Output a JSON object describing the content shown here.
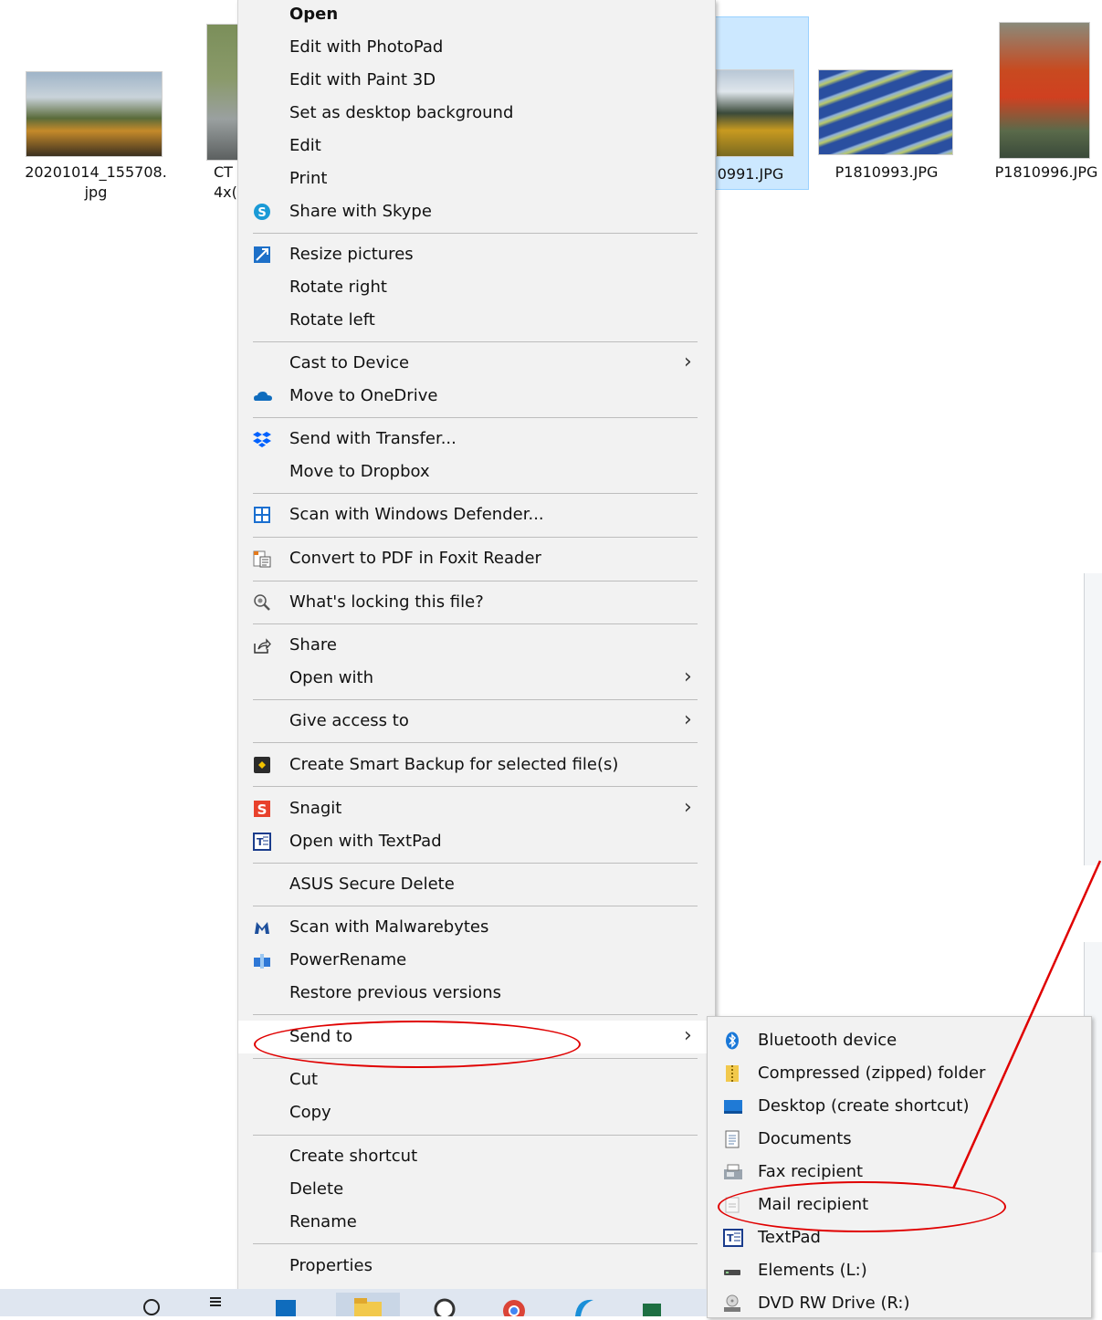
{
  "explorer": {
    "files": [
      {
        "name_line1": "20201014_155708.",
        "name_line2": "jpg"
      },
      {
        "name_line1": "CT",
        "name_line2": "4x("
      },
      {
        "name_line1": "0991.JPG",
        "name_line2": ""
      },
      {
        "name_line1": "P1810993.JPG",
        "name_line2": ""
      },
      {
        "name_line1": "P1810996.JPG",
        "name_line2": ""
      }
    ]
  },
  "context_menu": {
    "items": [
      {
        "label": "Open",
        "icon": "none"
      },
      {
        "label": "Edit with PhotoPad",
        "icon": "none"
      },
      {
        "label": "Edit with Paint 3D",
        "icon": "none"
      },
      {
        "label": "Set as desktop background",
        "icon": "none"
      },
      {
        "label": "Edit",
        "icon": "none"
      },
      {
        "label": "Print",
        "icon": "none"
      },
      {
        "label": "Share with Skype",
        "icon": "skype-icon"
      },
      {
        "label": "Resize pictures",
        "icon": "resize-pictures-icon"
      },
      {
        "label": "Rotate right",
        "icon": "none"
      },
      {
        "label": "Rotate left",
        "icon": "none"
      },
      {
        "label": "Cast to Device",
        "icon": "none"
      },
      {
        "label": "Move to OneDrive",
        "icon": "onedrive-icon"
      },
      {
        "label": "Send with Transfer...",
        "icon": "dropbox-icon"
      },
      {
        "label": "Move to Dropbox",
        "icon": "none"
      },
      {
        "label": "Scan with Windows Defender...",
        "icon": "windows-defender-icon"
      },
      {
        "label": "Convert to PDF in Foxit Reader",
        "icon": "foxit-icon"
      },
      {
        "label": "What's locking this file?",
        "icon": "magnifier-gear-icon"
      },
      {
        "label": "Share",
        "icon": "share-icon"
      },
      {
        "label": "Open with",
        "icon": "none"
      },
      {
        "label": "Give access to",
        "icon": "none"
      },
      {
        "label": "Create Smart Backup for selected file(s)",
        "icon": "smart-backup-icon"
      },
      {
        "label": "Snagit",
        "icon": "snagit-icon"
      },
      {
        "label": "Open with TextPad",
        "icon": "textpad-icon"
      },
      {
        "label": "ASUS Secure Delete",
        "icon": "none"
      },
      {
        "label": "Scan with Malwarebytes",
        "icon": "malwarebytes-icon"
      },
      {
        "label": "PowerRename",
        "icon": "powerrename-icon"
      },
      {
        "label": "Restore previous versions",
        "icon": "none"
      },
      {
        "label": "Send to",
        "icon": "none"
      },
      {
        "label": "Cut",
        "icon": "none"
      },
      {
        "label": "Copy",
        "icon": "none"
      },
      {
        "label": "Create shortcut",
        "icon": "none"
      },
      {
        "label": "Delete",
        "icon": "none"
      },
      {
        "label": "Rename",
        "icon": "none"
      },
      {
        "label": "Properties",
        "icon": "none"
      }
    ]
  },
  "send_to_menu": {
    "items": [
      {
        "label": "Bluetooth device",
        "icon": "bluetooth-icon"
      },
      {
        "label": "Compressed (zipped) folder",
        "icon": "zip-folder-icon"
      },
      {
        "label": "Desktop (create shortcut)",
        "icon": "desktop-icon"
      },
      {
        "label": "Documents",
        "icon": "documents-icon"
      },
      {
        "label": "Fax recipient",
        "icon": "fax-icon"
      },
      {
        "label": "Mail recipient",
        "icon": "mail-icon"
      },
      {
        "label": "TextPad",
        "icon": "textpad-icon"
      },
      {
        "label": "Elements (L:)",
        "icon": "drive-icon"
      },
      {
        "label": "DVD RW Drive (R:)",
        "icon": "dvd-drive-icon"
      }
    ]
  },
  "colors": {
    "annotation": "#e00000",
    "menu_bg": "#f2f2f2",
    "selection": "#cce8ff"
  }
}
